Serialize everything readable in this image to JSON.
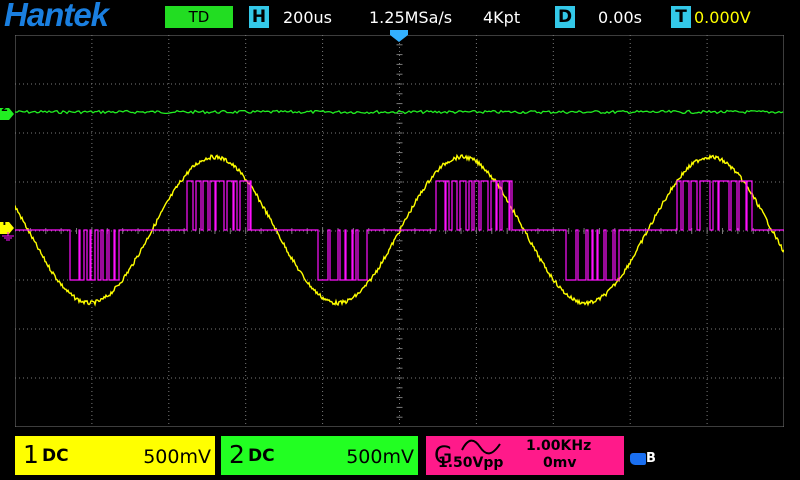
{
  "brand": "Hantek",
  "header": {
    "mode": "TD",
    "h_key": "H",
    "timebase": "200us",
    "sample_rate": "1.25MSa/s",
    "memory_depth": "4Kpt",
    "d_key": "D",
    "delay": "0.00s",
    "t_key": "T",
    "trigger_level": "0.000V"
  },
  "markers": {
    "ch2": "2",
    "ch1": "1",
    "ch3": "T"
  },
  "channels": [
    {
      "num": "1",
      "coupling": "DC",
      "scale": "500mV",
      "color": "#ffff00"
    },
    {
      "num": "2",
      "coupling": "DC",
      "scale": "500mV",
      "color": "#22ff22"
    }
  ],
  "generator": {
    "letter": "G",
    "frequency": "1.00KHz",
    "amplitude": "1.50Vpp",
    "offset": "0mv",
    "color": "#ff1a8a"
  },
  "status": {
    "usb_icon": "usb-icon",
    "usb_label": "B"
  },
  "colors": {
    "grid": "#7a7a7a",
    "ch1_trace": "#ffff00",
    "ch2_trace": "#22ee22",
    "pwm_trace": "#ff10ff",
    "accent_blue": "#1a7fe0",
    "key_cyan": "#33c8e8"
  }
}
